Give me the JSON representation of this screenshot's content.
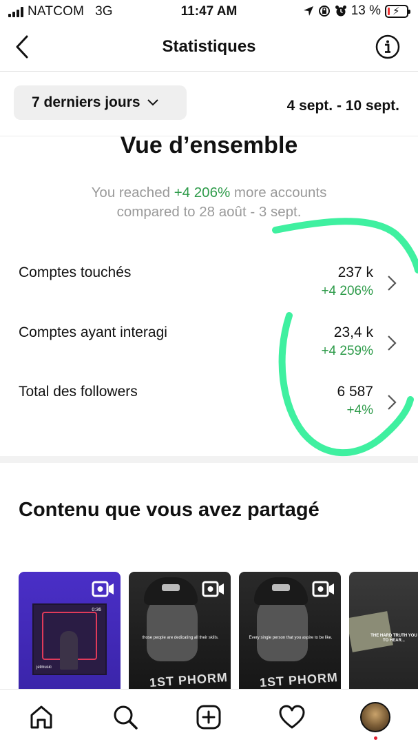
{
  "status_bar": {
    "carrier": "NATCOM",
    "network": "3G",
    "time": "11:47 AM",
    "battery_pct": "13 %",
    "battery_level": 0.13
  },
  "header": {
    "title": "Statistiques",
    "back_icon": "chevron-left-icon",
    "info_icon": "info-icon"
  },
  "filter": {
    "range_label": "7 derniers jours",
    "dates": "4 sept. - 10 sept."
  },
  "overview": {
    "title": "Vue d’ensemble",
    "reach_prefix": "You reached ",
    "reach_value": "+4 206%",
    "reach_suffix": " more accounts",
    "reach_compare": "compared to 28 août - 3 sept.",
    "metrics": [
      {
        "label": "Comptes touchés",
        "value": "237 k",
        "delta": "+4 206%"
      },
      {
        "label": "Comptes ayant interagi",
        "value": "23,4 k",
        "delta": "+4 259%"
      },
      {
        "label": "Total des followers",
        "value": "6 587",
        "delta": "+4%"
      }
    ]
  },
  "content": {
    "title": "Contenu que vous avez partagé",
    "thumbs": [
      {
        "time": "0:36",
        "tag": "jetmusic"
      },
      {
        "caption": "those people are dedicating all their skills.",
        "shirt": "1ST PHORM"
      },
      {
        "caption": "Every single person that you aspire to be like.",
        "shirt": "1ST PHORM"
      },
      {
        "caption": "THE HARD TRUTH YOU TO HEAR..."
      }
    ]
  },
  "colors": {
    "positive": "#2e9b4a",
    "annotation_stroke": "#3ff0a0",
    "muted_text": "#9a9a9a"
  }
}
